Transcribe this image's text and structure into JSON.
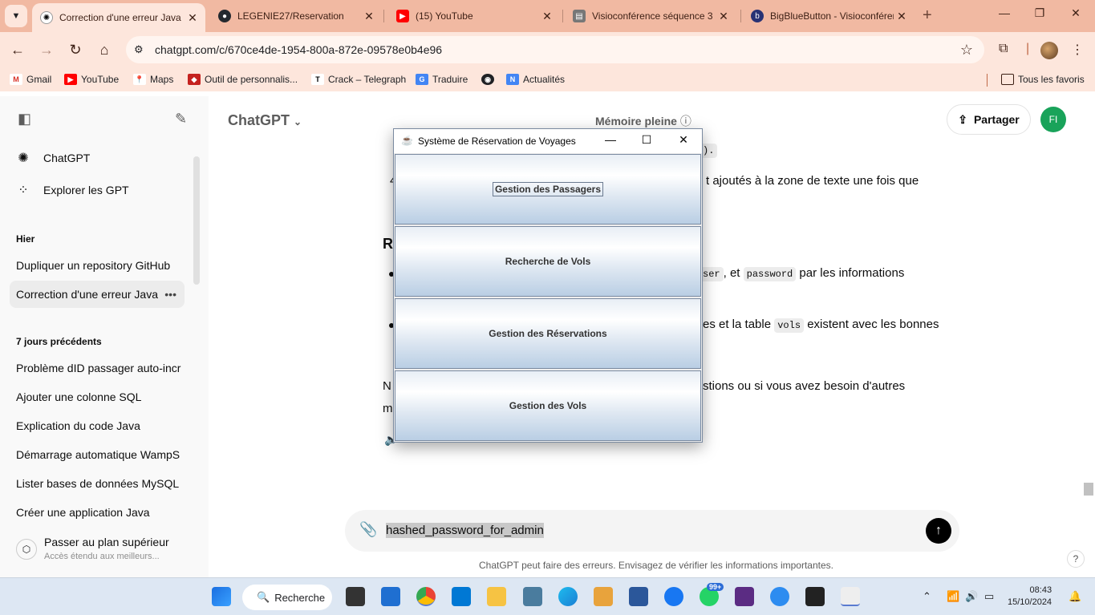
{
  "browser": {
    "tabs": [
      {
        "title": "Correction d'une erreur Java",
        "active": true,
        "icon": "chatgpt-icon"
      },
      {
        "title": "LEGENIE27/Reservation",
        "active": false,
        "icon": "github-icon"
      },
      {
        "title": "(15) YouTube",
        "active": false,
        "icon": "youtube-icon"
      },
      {
        "title": "Visioconférence séquence 3",
        "active": false,
        "icon": "document-icon"
      },
      {
        "title": "BigBlueButton - Visioconférence",
        "active": false,
        "icon": "bigbluebutton-icon"
      }
    ],
    "url": "chatgpt.com/c/670ce4de-1954-800a-872e-09578e0b4e96",
    "bookmarks": [
      {
        "label": "Gmail",
        "color": "#d93025"
      },
      {
        "label": "YouTube",
        "color": "#ff0000"
      },
      {
        "label": "Maps",
        "color": "#34a853"
      },
      {
        "label": "Outil de personnalis...",
        "color": "#c5221f"
      },
      {
        "label": "Crack – Telegraph",
        "color": "#000000"
      },
      {
        "label": "Traduire",
        "color": "#4285f4"
      },
      {
        "label": "",
        "color": "#202124"
      },
      {
        "label": "Actualités",
        "color": "#4285f4"
      }
    ],
    "all_bookmarks": "Tous les favoris"
  },
  "sidebar": {
    "top_items": [
      {
        "label": "ChatGPT",
        "icon": "chatgpt-logo-icon"
      },
      {
        "label": "Explorer les GPT",
        "icon": "grid-icon"
      }
    ],
    "section_yesterday": "Hier",
    "yesterday": [
      {
        "label": "Dupliquer un repository GitHub",
        "selected": false
      },
      {
        "label": "Correction d'une erreur Java",
        "selected": true
      }
    ],
    "section_week": "7 jours précédents",
    "week": [
      "Problème dID passager auto-incr",
      "Ajouter une colonne SQL",
      "Explication du code Java",
      "Démarrage automatique WampS",
      "Lister bases de données MySQL",
      "Créer une application Java"
    ],
    "upgrade_title": "Passer au plan supérieur",
    "upgrade_sub": "Accès étendu aux meilleurs..."
  },
  "main": {
    "title": "ChatGPT",
    "memory": "Mémoire pleine",
    "share": "Partager",
    "avatar": "FI",
    "lines": {
      "l1_tail": ").",
      "l2_num": "4",
      "l2_tail": "t ajoutés à la zone de texte une fois que",
      "heading_frag": "Re",
      "b1_code1": "ser",
      "b1_mid": ", et",
      "b1_code2": "password",
      "b1_tail": "par les informations",
      "b2_pre": "es et la table",
      "b2_code": "vols",
      "b2_tail": "existent avec les bonnes",
      "p_start": "N",
      "p_tail": "stions ou si vous avez besoin d'autres",
      "p2_start": "m"
    },
    "composer_text": "hashed_password_for_admin",
    "disclaimer": "ChatGPT peut faire des erreurs. Envisagez de vérifier les informations importantes.",
    "help": "?"
  },
  "java_window": {
    "title": "Système de Réservation de Voyages",
    "buttons": [
      "Gestion des Passagers",
      "Recherche de Vols",
      "Gestion des Réservations",
      "Gestion des Vols"
    ]
  },
  "taskbar": {
    "search": "Recherche",
    "badge": "99+",
    "time": "08:43",
    "date": "15/10/2024"
  }
}
